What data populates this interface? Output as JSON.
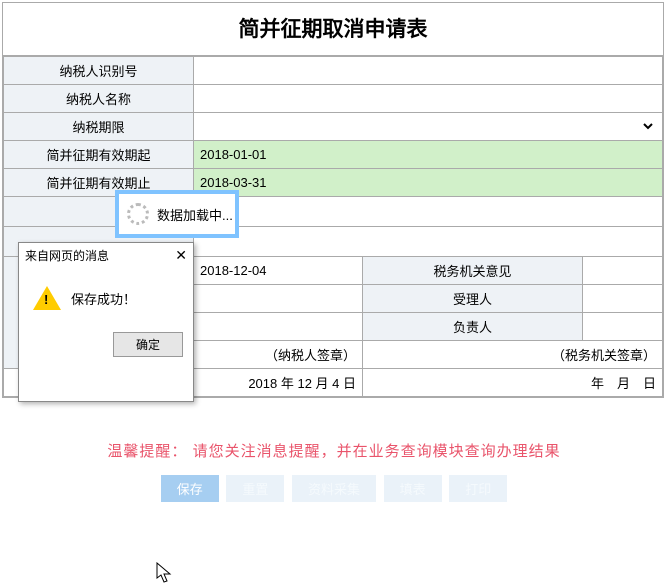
{
  "title": "简并征期取消申请表",
  "rows": {
    "taxpayer_id_label": "纳税人识别号",
    "taxpayer_id_value": "",
    "taxpayer_name_label": "纳税人名称",
    "taxpayer_name_value": "",
    "tax_period_label": "纳税期限",
    "tax_period_value": "",
    "valid_from_label": "简并征期有效期起",
    "valid_from_value": "2018-01-01",
    "valid_to_label": "简并征期有效期止",
    "valid_to_value": "2018-03-31",
    "apply_date_value": "2018-12-04",
    "tax_opinion_label": "税务机关意见",
    "handler_label": "受理人",
    "handler_value": "",
    "manager_label": "负责人",
    "manager_value": ""
  },
  "sign": {
    "taxpayer_sign": "（纳税人签章）",
    "taxpayer_date": "2018 年 12 月 4 日",
    "tax_sign": "（税务机关签章）",
    "tax_date": "年　月　日"
  },
  "reminder": {
    "prefix": "温馨提醒：",
    "text": "请您关注消息提醒，并在业务查询模块查询办理结果"
  },
  "buttons": [
    "保存",
    "重置",
    "资料采集",
    "填表",
    "打印"
  ],
  "loading": {
    "text": "数据加载中..."
  },
  "dialog": {
    "title": "来自网页的消息",
    "message": "保存成功！",
    "ok": "确定"
  }
}
